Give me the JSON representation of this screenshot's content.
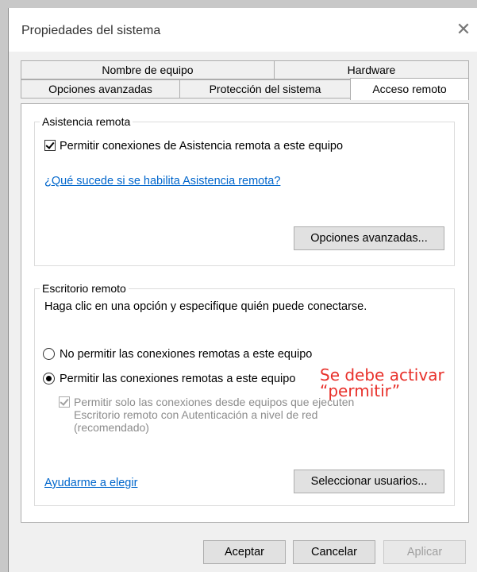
{
  "window": {
    "title": "Propiedades del sistema",
    "close_glyph": "✕"
  },
  "tabs": {
    "row1": [
      {
        "label": "Nombre de equipo"
      },
      {
        "label": "Hardware"
      }
    ],
    "row2": [
      {
        "label": "Opciones avanzadas"
      },
      {
        "label": "Protección del sistema"
      },
      {
        "label": "Acceso remoto",
        "active": true
      }
    ]
  },
  "asistencia": {
    "legend": "Asistencia remota",
    "checkbox_label": "Permitir conexiones de Asistencia remota a este equipo",
    "checkbox_checked": true,
    "link": "¿Qué sucede si se habilita Asistencia remota?",
    "advanced_button": "Opciones avanzadas..."
  },
  "escritorio": {
    "legend": "Escritorio remoto",
    "instruction": "Haga clic en una opción y especifique quién puede conectarse.",
    "radio_no": "No permitir las conexiones remotas a este equipo",
    "radio_yes": "Permitir las conexiones remotas a este equipo",
    "selected": "yes",
    "nla_line1": "Permitir solo las conexiones desde equipos que ejecuten",
    "nla_line2": "Escritorio remoto con Autenticación a nivel de red",
    "nla_line3": "(recomendado)",
    "nla_checked": true,
    "help_link": "Ayudarme a elegir",
    "select_users_button": "Seleccionar usuarios..."
  },
  "annotation": {
    "line1": "Se debe activar",
    "line2": "“permitir”",
    "color": "#e8302a"
  },
  "footer": {
    "ok": "Aceptar",
    "cancel": "Cancelar",
    "apply": "Aplicar"
  }
}
